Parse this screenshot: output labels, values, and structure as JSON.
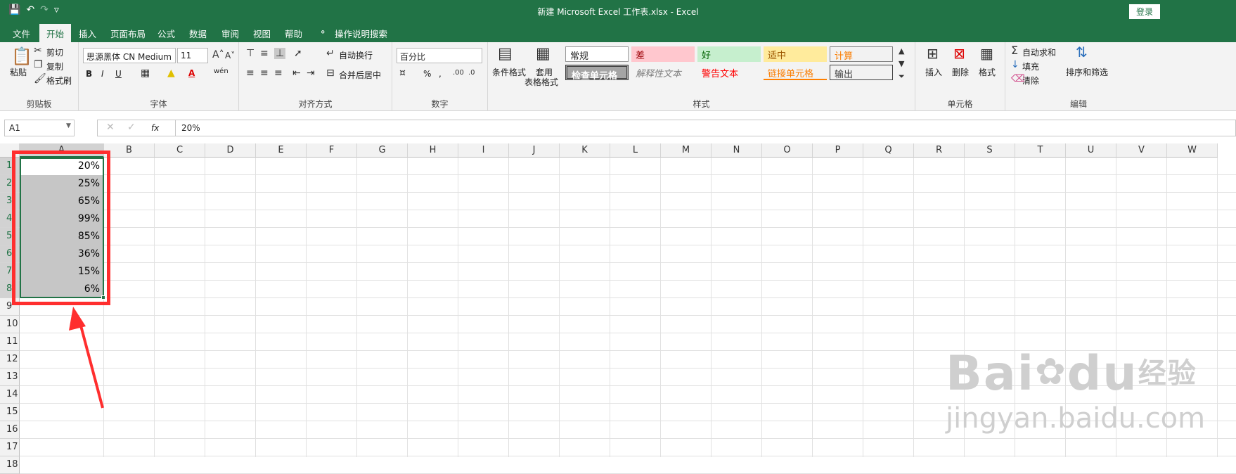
{
  "titlebar": {
    "title": "新建 Microsoft Excel 工作表.xlsx  -  Excel",
    "login": "登录",
    "save_icon": "save-icon",
    "undo_icon": "undo-icon",
    "redo_icon": "redo-icon"
  },
  "tabs": [
    "文件",
    "开始",
    "插入",
    "页面布局",
    "公式",
    "数据",
    "审阅",
    "视图",
    "帮助",
    "操作说明搜索"
  ],
  "ribbon": {
    "clipboard": {
      "paste": "粘贴",
      "cut": "剪切",
      "copy": "复制",
      "format_painter": "格式刷",
      "label": "剪贴板"
    },
    "font": {
      "name": "思源黑体 CN Medium",
      "size": "11",
      "bold": "B",
      "italic": "I",
      "underline": "U",
      "label": "字体",
      "font_color_icon": "A",
      "wen": "wén"
    },
    "align": {
      "wrap": "自动换行",
      "merge": "合并后居中",
      "label": "对齐方式"
    },
    "number": {
      "format": "百分比",
      "percent": "%",
      "comma": ",",
      "label": "数字"
    },
    "styles": {
      "cond_format": "条件格式",
      "table_format": "套用",
      "table_format2": "表格格式",
      "label": "样式",
      "boxes": [
        {
          "text": "常规"
        },
        {
          "text": "差"
        },
        {
          "text": "好"
        },
        {
          "text": "适中"
        },
        {
          "text": "计算"
        },
        {
          "text": "检查单元格"
        },
        {
          "text": "解释性文本"
        },
        {
          "text": "警告文本"
        },
        {
          "text": "链接单元格"
        },
        {
          "text": "输出"
        }
      ]
    },
    "cells": {
      "insert": "插入",
      "delete": "删除",
      "format": "格式",
      "label": "单元格"
    },
    "editing": {
      "autosum": "自动求和",
      "fill": "填充",
      "clear": "清除",
      "sort": "排序和筛选",
      "label": "编辑"
    }
  },
  "formula_bar": {
    "name_box": "A1",
    "fx": "fx",
    "value": "20%"
  },
  "columns": [
    "A",
    "B",
    "C",
    "D",
    "E",
    "F",
    "G",
    "H",
    "I",
    "J",
    "K",
    "L",
    "M",
    "N",
    "O",
    "P",
    "Q",
    "R",
    "S",
    "T",
    "U",
    "V",
    "W"
  ],
  "rows": [
    "1",
    "2",
    "3",
    "4",
    "5",
    "6",
    "7",
    "8",
    "9",
    "10",
    "11",
    "12",
    "13",
    "14",
    "15",
    "16",
    "17",
    "18"
  ],
  "cells_A": [
    "20%",
    "25%",
    "65%",
    "99%",
    "85%",
    "36%",
    "15%",
    "6%"
  ],
  "watermark": {
    "brand": "Bai",
    "brand2": "du",
    "brand3": "经验",
    "url": "jingyan.baidu.com"
  },
  "colors": {
    "accent": "#217346",
    "annotation": "#ff2e2e",
    "selection": "#c6c6c6"
  }
}
